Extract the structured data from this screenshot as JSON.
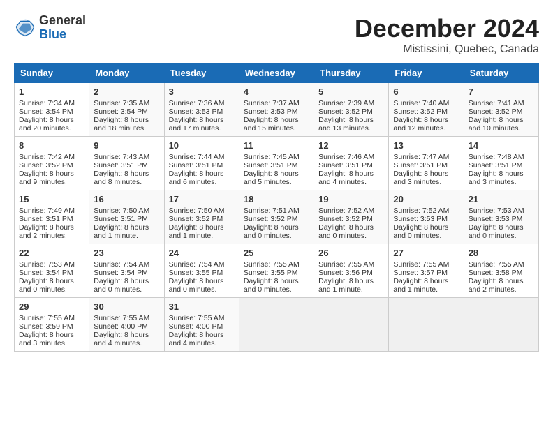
{
  "header": {
    "logo_general": "General",
    "logo_blue": "Blue",
    "month_title": "December 2024",
    "location": "Mistissini, Quebec, Canada"
  },
  "days_of_week": [
    "Sunday",
    "Monday",
    "Tuesday",
    "Wednesday",
    "Thursday",
    "Friday",
    "Saturday"
  ],
  "weeks": [
    [
      {
        "day": "1",
        "sunrise": "Sunrise: 7:34 AM",
        "sunset": "Sunset: 3:54 PM",
        "daylight": "Daylight: 8 hours and 20 minutes."
      },
      {
        "day": "2",
        "sunrise": "Sunrise: 7:35 AM",
        "sunset": "Sunset: 3:54 PM",
        "daylight": "Daylight: 8 hours and 18 minutes."
      },
      {
        "day": "3",
        "sunrise": "Sunrise: 7:36 AM",
        "sunset": "Sunset: 3:53 PM",
        "daylight": "Daylight: 8 hours and 17 minutes."
      },
      {
        "day": "4",
        "sunrise": "Sunrise: 7:37 AM",
        "sunset": "Sunset: 3:53 PM",
        "daylight": "Daylight: 8 hours and 15 minutes."
      },
      {
        "day": "5",
        "sunrise": "Sunrise: 7:39 AM",
        "sunset": "Sunset: 3:52 PM",
        "daylight": "Daylight: 8 hours and 13 minutes."
      },
      {
        "day": "6",
        "sunrise": "Sunrise: 7:40 AM",
        "sunset": "Sunset: 3:52 PM",
        "daylight": "Daylight: 8 hours and 12 minutes."
      },
      {
        "day": "7",
        "sunrise": "Sunrise: 7:41 AM",
        "sunset": "Sunset: 3:52 PM",
        "daylight": "Daylight: 8 hours and 10 minutes."
      }
    ],
    [
      {
        "day": "8",
        "sunrise": "Sunrise: 7:42 AM",
        "sunset": "Sunset: 3:52 PM",
        "daylight": "Daylight: 8 hours and 9 minutes."
      },
      {
        "day": "9",
        "sunrise": "Sunrise: 7:43 AM",
        "sunset": "Sunset: 3:51 PM",
        "daylight": "Daylight: 8 hours and 8 minutes."
      },
      {
        "day": "10",
        "sunrise": "Sunrise: 7:44 AM",
        "sunset": "Sunset: 3:51 PM",
        "daylight": "Daylight: 8 hours and 6 minutes."
      },
      {
        "day": "11",
        "sunrise": "Sunrise: 7:45 AM",
        "sunset": "Sunset: 3:51 PM",
        "daylight": "Daylight: 8 hours and 5 minutes."
      },
      {
        "day": "12",
        "sunrise": "Sunrise: 7:46 AM",
        "sunset": "Sunset: 3:51 PM",
        "daylight": "Daylight: 8 hours and 4 minutes."
      },
      {
        "day": "13",
        "sunrise": "Sunrise: 7:47 AM",
        "sunset": "Sunset: 3:51 PM",
        "daylight": "Daylight: 8 hours and 3 minutes."
      },
      {
        "day": "14",
        "sunrise": "Sunrise: 7:48 AM",
        "sunset": "Sunset: 3:51 PM",
        "daylight": "Daylight: 8 hours and 3 minutes."
      }
    ],
    [
      {
        "day": "15",
        "sunrise": "Sunrise: 7:49 AM",
        "sunset": "Sunset: 3:51 PM",
        "daylight": "Daylight: 8 hours and 2 minutes."
      },
      {
        "day": "16",
        "sunrise": "Sunrise: 7:50 AM",
        "sunset": "Sunset: 3:51 PM",
        "daylight": "Daylight: 8 hours and 1 minute."
      },
      {
        "day": "17",
        "sunrise": "Sunrise: 7:50 AM",
        "sunset": "Sunset: 3:52 PM",
        "daylight": "Daylight: 8 hours and 1 minute."
      },
      {
        "day": "18",
        "sunrise": "Sunrise: 7:51 AM",
        "sunset": "Sunset: 3:52 PM",
        "daylight": "Daylight: 8 hours and 0 minutes."
      },
      {
        "day": "19",
        "sunrise": "Sunrise: 7:52 AM",
        "sunset": "Sunset: 3:52 PM",
        "daylight": "Daylight: 8 hours and 0 minutes."
      },
      {
        "day": "20",
        "sunrise": "Sunrise: 7:52 AM",
        "sunset": "Sunset: 3:53 PM",
        "daylight": "Daylight: 8 hours and 0 minutes."
      },
      {
        "day": "21",
        "sunrise": "Sunrise: 7:53 AM",
        "sunset": "Sunset: 3:53 PM",
        "daylight": "Daylight: 8 hours and 0 minutes."
      }
    ],
    [
      {
        "day": "22",
        "sunrise": "Sunrise: 7:53 AM",
        "sunset": "Sunset: 3:54 PM",
        "daylight": "Daylight: 8 hours and 0 minutes."
      },
      {
        "day": "23",
        "sunrise": "Sunrise: 7:54 AM",
        "sunset": "Sunset: 3:54 PM",
        "daylight": "Daylight: 8 hours and 0 minutes."
      },
      {
        "day": "24",
        "sunrise": "Sunrise: 7:54 AM",
        "sunset": "Sunset: 3:55 PM",
        "daylight": "Daylight: 8 hours and 0 minutes."
      },
      {
        "day": "25",
        "sunrise": "Sunrise: 7:55 AM",
        "sunset": "Sunset: 3:55 PM",
        "daylight": "Daylight: 8 hours and 0 minutes."
      },
      {
        "day": "26",
        "sunrise": "Sunrise: 7:55 AM",
        "sunset": "Sunset: 3:56 PM",
        "daylight": "Daylight: 8 hours and 1 minute."
      },
      {
        "day": "27",
        "sunrise": "Sunrise: 7:55 AM",
        "sunset": "Sunset: 3:57 PM",
        "daylight": "Daylight: 8 hours and 1 minute."
      },
      {
        "day": "28",
        "sunrise": "Sunrise: 7:55 AM",
        "sunset": "Sunset: 3:58 PM",
        "daylight": "Daylight: 8 hours and 2 minutes."
      }
    ],
    [
      {
        "day": "29",
        "sunrise": "Sunrise: 7:55 AM",
        "sunset": "Sunset: 3:59 PM",
        "daylight": "Daylight: 8 hours and 3 minutes."
      },
      {
        "day": "30",
        "sunrise": "Sunrise: 7:55 AM",
        "sunset": "Sunset: 4:00 PM",
        "daylight": "Daylight: 8 hours and 4 minutes."
      },
      {
        "day": "31",
        "sunrise": "Sunrise: 7:55 AM",
        "sunset": "Sunset: 4:00 PM",
        "daylight": "Daylight: 8 hours and 4 minutes."
      },
      null,
      null,
      null,
      null
    ]
  ]
}
